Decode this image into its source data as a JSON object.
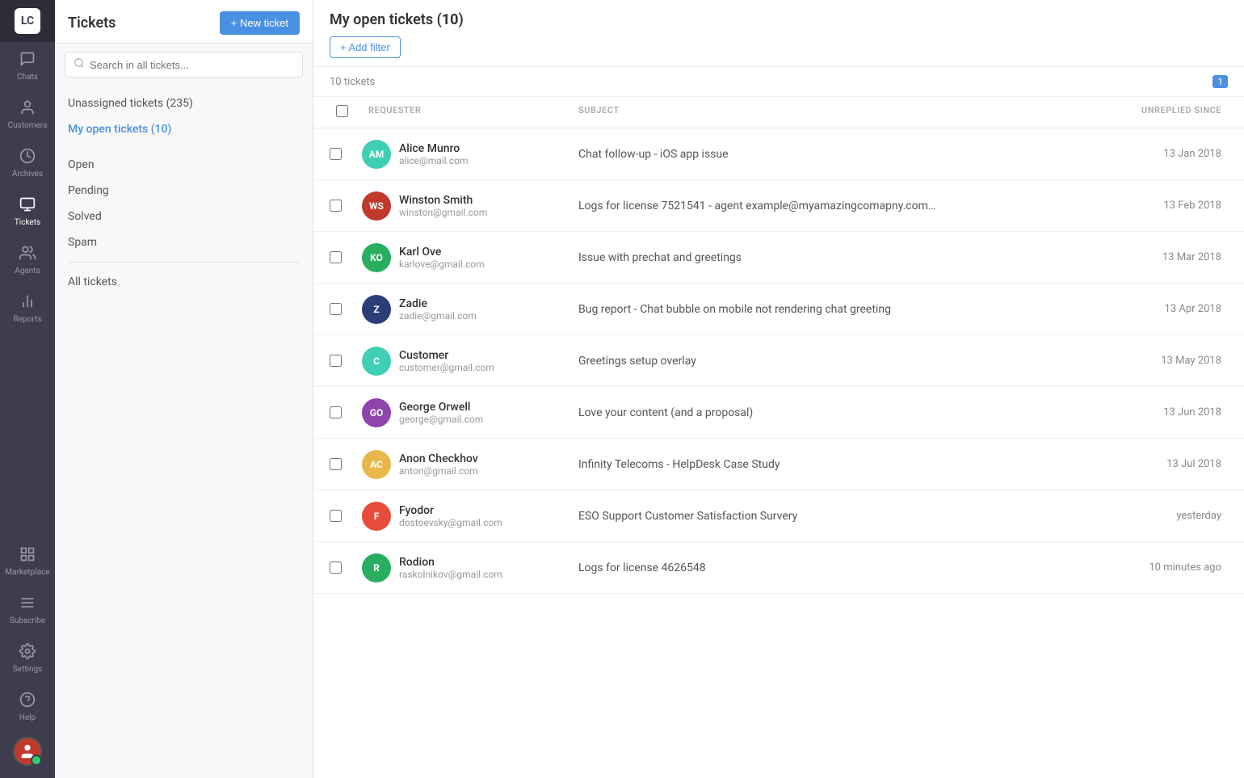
{
  "app": {
    "logo": "LC"
  },
  "sidebar": {
    "items": [
      {
        "id": "chats",
        "label": "Chats",
        "icon": "💬",
        "active": false
      },
      {
        "id": "customers",
        "label": "Customers",
        "icon": "👤",
        "active": false
      },
      {
        "id": "archives",
        "label": "Archives",
        "icon": "🕐",
        "active": false
      },
      {
        "id": "tickets",
        "label": "Tickets",
        "icon": "🎫",
        "active": true
      },
      {
        "id": "agents",
        "label": "Agents",
        "icon": "👥",
        "active": false
      },
      {
        "id": "reports",
        "label": "Reports",
        "icon": "📊",
        "active": false
      }
    ],
    "bottom_items": [
      {
        "id": "marketplace",
        "label": "Marketplace",
        "icon": "⊞"
      },
      {
        "id": "subscribe",
        "label": "Subscribe",
        "icon": "☰"
      },
      {
        "id": "settings",
        "label": "Settings",
        "icon": "⚙"
      },
      {
        "id": "help",
        "label": "Help",
        "icon": "?"
      }
    ]
  },
  "left_panel": {
    "title": "Tickets",
    "new_ticket_btn": "+ New ticket",
    "search_placeholder": "Search in all tickets...",
    "nav_items": [
      {
        "id": "unassigned",
        "label": "Unassigned tickets (235)",
        "active": false
      },
      {
        "id": "my_open",
        "label": "My open tickets (10)",
        "active": true
      }
    ],
    "section_items": [
      {
        "id": "open",
        "label": "Open"
      },
      {
        "id": "pending",
        "label": "Pending"
      },
      {
        "id": "solved",
        "label": "Solved"
      },
      {
        "id": "spam",
        "label": "Spam"
      }
    ],
    "all_tickets": "All tickets"
  },
  "main": {
    "title": "My open tickets",
    "count": 10,
    "add_filter_label": "+ Add filter",
    "tickets_count_label": "10 tickets",
    "page_number": "1",
    "table_headers": {
      "requester": "REQUESTER",
      "subject": "SUBJECT",
      "unreplied_since": "UNREPLIED SINCE"
    },
    "tickets": [
      {
        "id": 1,
        "initials": "AM",
        "name": "Alice Munro",
        "email": "alice@mail.com",
        "subject": "Chat follow-up - iOS app issue",
        "unreplied_since": "13 Jan 2018",
        "avatar_color": "#3fcfb4"
      },
      {
        "id": 2,
        "initials": "WS",
        "name": "Winston Smith",
        "email": "winston@gmail.com",
        "subject": "Logs for license 7521541 - agent example@myamazingcomapny.com…",
        "unreplied_since": "13 Feb 2018",
        "avatar_color": "#c0392b"
      },
      {
        "id": 3,
        "initials": "KO",
        "name": "Karl Ove",
        "email": "karlove@gmail.com",
        "subject": "Issue with prechat and greetings",
        "unreplied_since": "13 Mar 2018",
        "avatar_color": "#27ae60"
      },
      {
        "id": 4,
        "initials": "Z",
        "name": "Zadie",
        "email": "zadie@gmail.com",
        "subject": "Bug report - Chat bubble on mobile not rendering chat greeting",
        "unreplied_since": "13 Apr 2018",
        "avatar_color": "#2c3e7a"
      },
      {
        "id": 5,
        "initials": "C",
        "name": "Customer",
        "email": "customer@gmail.com",
        "subject": "Greetings setup overlay",
        "unreplied_since": "13 May 2018",
        "avatar_color": "#3fcfb4"
      },
      {
        "id": 6,
        "initials": "GO",
        "name": "George Orwell",
        "email": "george@gmail.com",
        "subject": "Love your content (and a proposal)",
        "unreplied_since": "13 Jun 2018",
        "avatar_color": "#8e44ad"
      },
      {
        "id": 7,
        "initials": "AC",
        "name": "Anon Checkhov",
        "email": "anton@gmail.com",
        "subject": "Infinity Telecoms - HelpDesk Case Study",
        "unreplied_since": "13 Jul 2018",
        "avatar_color": "#e8b84b"
      },
      {
        "id": 8,
        "initials": "F",
        "name": "Fyodor",
        "email": "dostoevsky@gmail.com",
        "subject": "ESO Support Customer Satisfaction Survery",
        "unreplied_since": "yesterday",
        "avatar_color": "#e74c3c"
      },
      {
        "id": 9,
        "initials": "R",
        "name": "Rodion",
        "email": "raskolnikov@gmail.com",
        "subject": "Logs for license 4626548",
        "unreplied_since": "10 minutes ago",
        "avatar_color": "#27ae60"
      }
    ]
  }
}
